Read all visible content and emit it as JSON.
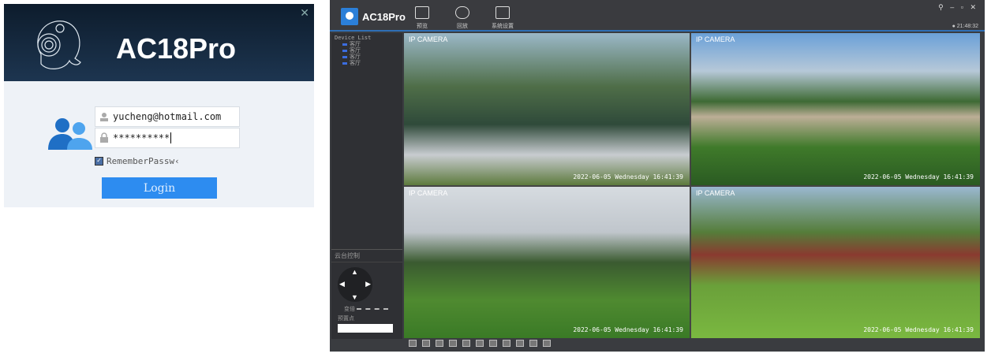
{
  "login": {
    "brand": "AC18Pro",
    "close": "✕",
    "username": "yucheng@hotmail.com",
    "password": "**********",
    "remember_label": "RememberPassw‹",
    "remember_checked": true,
    "login_button": "Login"
  },
  "app": {
    "title": "AC18Pro",
    "nav": [
      {
        "label": "预览"
      },
      {
        "label": "回放"
      },
      {
        "label": "系统设置"
      }
    ],
    "window_controls": "⚲ – ▫ ✕",
    "clock": "21:48:32",
    "device_list": {
      "title": "Device List",
      "items": [
        "客厅",
        "客厅",
        "客厅",
        "客厅"
      ]
    },
    "ptz": {
      "title": "云台控制",
      "zoom_label": "变倍",
      "preset_label": "预置点"
    },
    "cameras": [
      {
        "label": "IP CAMERA",
        "timestamp": "2022-06-05  Wednesday  16:41:39"
      },
      {
        "label": "IP CAMERA",
        "timestamp": "2022-06-05  Wednesday  16:41:39"
      },
      {
        "label": "IP CAMERA",
        "timestamp": "2022-06-05  Wednesday  16:41:39"
      },
      {
        "label": "IP CAMERA",
        "timestamp": "2022-06-05  Wednesday  16:41:39"
      }
    ]
  }
}
